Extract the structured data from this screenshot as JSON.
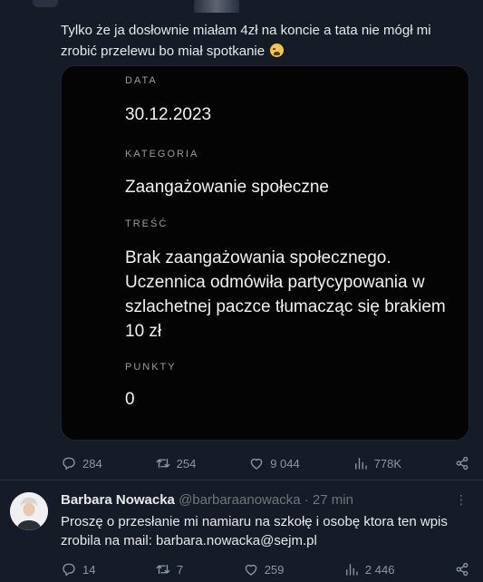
{
  "tweet": {
    "text": "Tylko że ja dosłownie miałam 4zł na koncie a tata nie mógł mi zrobić przelewu bo miał spotkanie",
    "emoji": "crying-face-emoji"
  },
  "card": {
    "fields": [
      {
        "label": "DATA",
        "value": "30.12.2023"
      },
      {
        "label": "KATEGORIA",
        "value": "Zaangażowanie społeczne"
      },
      {
        "label": "TREŚĆ",
        "value": "Brak zaangażowania społecznego. Uczennica odmówiła partycypowania w szlachetnej paczce tłumacząc się brakiem 10 zł"
      },
      {
        "label": "PUNKTY",
        "value": "0"
      }
    ]
  },
  "tweet_actions": {
    "replies": "284",
    "retweets": "254",
    "likes": "9 044",
    "views": "778K"
  },
  "reply": {
    "name": "Barbara Nowacka",
    "handle": "@barbaraanowacka",
    "time": "· 27 min",
    "text": "Proszę o przesłanie mi namiaru na szkołę i osobę ktora ten wpis zrobila na mail: barbara.nowacka@sejm.pl",
    "actions": {
      "replies": "14",
      "retweets": "7",
      "likes": "259",
      "views": "2 446"
    }
  },
  "colors": {
    "background": "#151b27",
    "card": "#040404",
    "muted": "#8b98a5"
  }
}
